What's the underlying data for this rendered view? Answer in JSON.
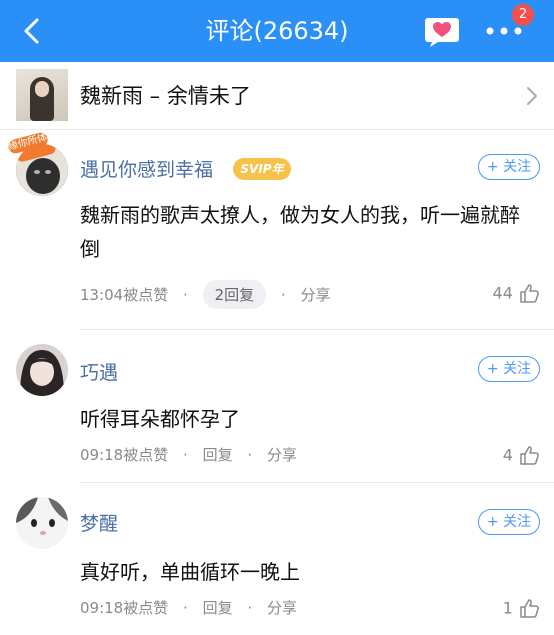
{
  "header": {
    "title": "评论(26634)",
    "badge_count": "2",
    "colors": {
      "bar": "#2a8ff7",
      "badge": "#f2514d"
    }
  },
  "song": {
    "title": "魏新雨 – 余情未了"
  },
  "comments": [
    {
      "username": "遇见你感到幸福",
      "vip_label": "SVIP年",
      "follow_label": "+ 关注",
      "content": "魏新雨的歌声太撩人，做为女人的我，听一遍就醉倒",
      "time": "13:04被点赞",
      "reply_label": "2回复",
      "share_label": "分享",
      "likes": "44",
      "avatar_tag": "缘你所体"
    },
    {
      "username": "巧遇",
      "follow_label": "+ 关注",
      "content": "听得耳朵都怀孕了",
      "time": "09:18被点赞",
      "reply_label": "回复",
      "share_label": "分享",
      "likes": "4"
    },
    {
      "username": "梦醒",
      "follow_label": "+ 关注",
      "content": "真好听，单曲循环一晚上",
      "time": "09:18被点赞",
      "reply_label": "回复",
      "share_label": "分享",
      "likes": "1"
    }
  ]
}
